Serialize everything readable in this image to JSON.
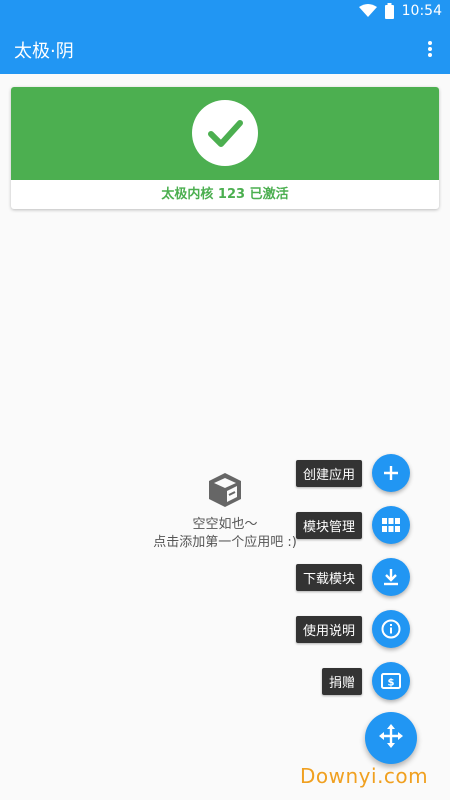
{
  "status_bar": {
    "time": "10:54"
  },
  "app_bar": {
    "title": "太极·阴",
    "menu_icon": "more-vert-icon"
  },
  "status_card": {
    "icon": "check-icon",
    "text": "太极内核 123 已激活",
    "color": "#4caf50"
  },
  "empty_state": {
    "icon": "box-icon",
    "line1": "空空如也～",
    "line2": "点击添加第一个应用吧 :)"
  },
  "fab_menu": {
    "items": [
      {
        "label": "创建应用",
        "icon": "plus-icon"
      },
      {
        "label": "模块管理",
        "icon": "grid-icon"
      },
      {
        "label": "下载模块",
        "icon": "download-icon"
      },
      {
        "label": "使用说明",
        "icon": "info-icon"
      },
      {
        "label": "捐赠",
        "icon": "money-icon"
      }
    ],
    "main_icon": "move-arrows-icon"
  },
  "watermark": "Downyi.com",
  "colors": {
    "primary": "#2196f3",
    "success": "#4caf50",
    "label_bg": "#333333"
  }
}
